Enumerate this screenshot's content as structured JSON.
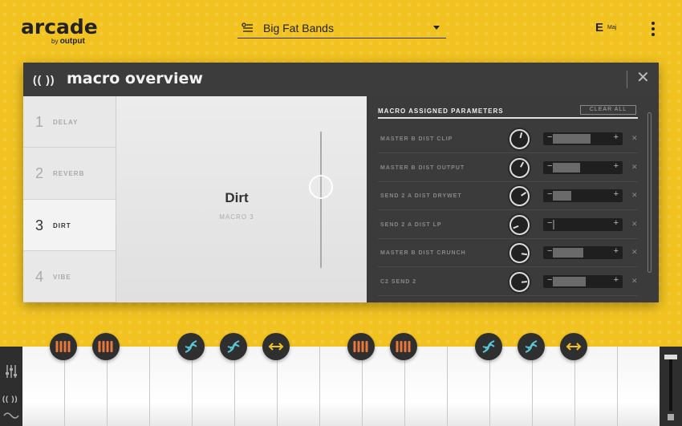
{
  "app": {
    "logo": "arcade",
    "logo_by": "by",
    "logo_brand": "output"
  },
  "header": {
    "preset_name": "Big Fat Bands",
    "key": "E",
    "scale": "Maj"
  },
  "panel": {
    "logo": "((  ))",
    "title": "macro overview",
    "close": "✕"
  },
  "macros": [
    {
      "num": "1",
      "name": "DELAY"
    },
    {
      "num": "2",
      "name": "REVERB"
    },
    {
      "num": "3",
      "name": "DIRT"
    },
    {
      "num": "4",
      "name": "VIBE"
    }
  ],
  "selected_macro": {
    "name": "Dirt",
    "sub": "MACRO 3",
    "level": 0.6
  },
  "params": {
    "header": "MACRO ASSIGNED PARAMETERS",
    "clear_all": "CLEAR ALL",
    "rows": [
      {
        "label": "MASTER B DIST CLIP",
        "knob": 0.55,
        "start": 0.0,
        "end": 0.62
      },
      {
        "label": "MASTER B DIST OUTPUT",
        "knob": 0.6,
        "start": 0.0,
        "end": 0.45
      },
      {
        "label": "SEND 2 A DIST DRYWET",
        "knob": 0.7,
        "start": 0.0,
        "end": 0.3
      },
      {
        "label": "SEND 2 A DIST LP",
        "knob": 0.1,
        "start": 0.0,
        "end": 0.0
      },
      {
        "label": "MASTER B DIST CRUNCH",
        "knob": 0.85,
        "start": 0.0,
        "end": 0.5
      },
      {
        "label": "C2 SEND 2",
        "knob": 0.8,
        "start": 0.0,
        "end": 0.55
      }
    ]
  },
  "keyboard_buttons": [
    {
      "name": "bars-button",
      "icon": "bars-icon",
      "color": "#e8783c"
    },
    {
      "name": "bars-button",
      "icon": "bars-icon",
      "color": "#e8783c"
    },
    {
      "name": "dna-button",
      "icon": "dna-icon",
      "color": "#5bc7d6"
    },
    {
      "name": "dna-button",
      "icon": "dna-icon",
      "color": "#5bc7d6"
    },
    {
      "name": "stretch-button",
      "icon": "double-arrow-icon",
      "color": "#f2c320"
    },
    {
      "name": "bars-button",
      "icon": "bars-icon",
      "color": "#e8783c"
    },
    {
      "name": "bars-button",
      "icon": "bars-icon",
      "color": "#e8783c"
    },
    {
      "name": "dna-button",
      "icon": "dna-icon",
      "color": "#5bc7d6"
    },
    {
      "name": "dna-button",
      "icon": "dna-icon",
      "color": "#5bc7d6"
    },
    {
      "name": "stretch-button",
      "icon": "double-arrow-icon",
      "color": "#f2c320"
    }
  ],
  "colors": {
    "background": "#f2c320",
    "panel": "#3a3a3a",
    "orange": "#e8783c",
    "teal": "#5bc7d6"
  },
  "left_sidebar": {
    "macro_icon": "(( ))"
  }
}
